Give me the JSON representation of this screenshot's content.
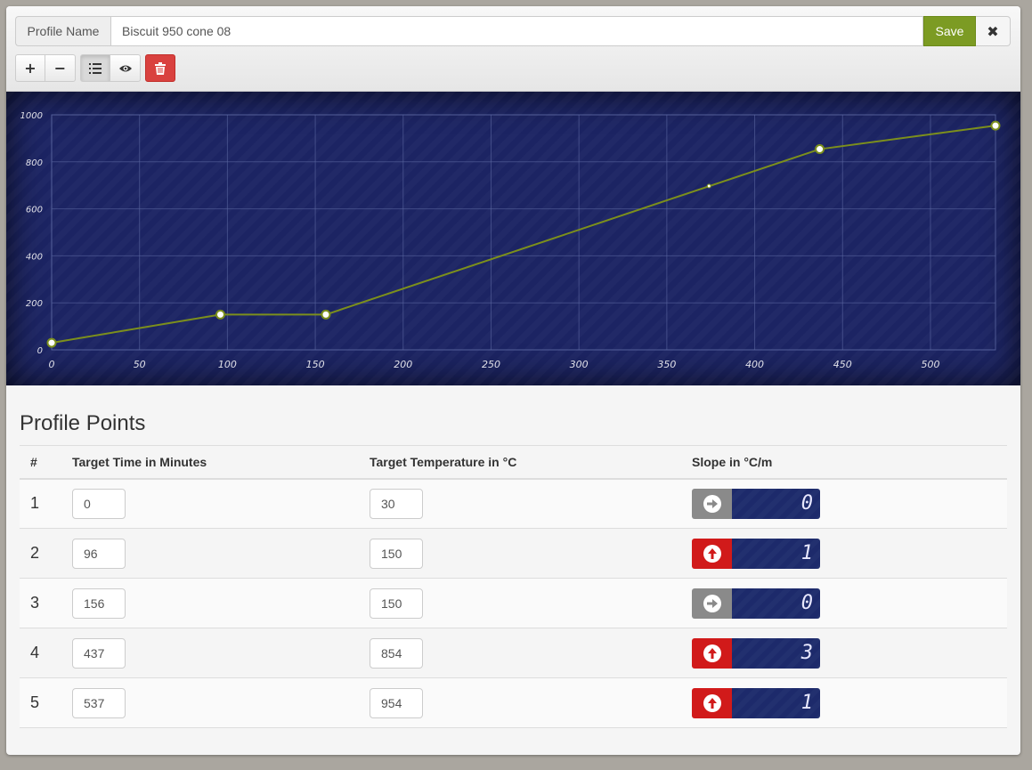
{
  "profile": {
    "name_label": "Profile Name",
    "name_value": "Biscuit 950 cone 08",
    "save_label": "Save",
    "close_glyph": "✖"
  },
  "toolbar": {
    "add_glyph": "+",
    "remove_glyph": "−",
    "list_icon": "list-icon",
    "view_icon": "eye-icon",
    "delete_icon": "trash-icon"
  },
  "chart_data": {
    "type": "line",
    "x": [
      0,
      96,
      156,
      437,
      537
    ],
    "y": [
      30,
      150,
      150,
      854,
      954
    ],
    "midpoint_marker": {
      "x": 374,
      "y": 697
    },
    "xlim": [
      0,
      537
    ],
    "ylim": [
      0,
      1000
    ],
    "xticks": [
      0,
      50,
      100,
      150,
      200,
      250,
      300,
      350,
      400,
      450,
      500
    ],
    "yticks": [
      0,
      200,
      400,
      600,
      800,
      1000
    ],
    "grid": true,
    "colors": {
      "background": "#1c2463",
      "line": "#7c8f1c",
      "point_fill": "#ffffff",
      "grid": "#5a66a0",
      "tick_text": "#e0e0e8"
    }
  },
  "points_section": {
    "title": "Profile Points",
    "headers": [
      "#",
      "Target Time in Minutes",
      "Target Temperature in °C",
      "Slope in °C/m"
    ],
    "rows": [
      {
        "index": "1",
        "time": "0",
        "temp": "30",
        "slope": "0",
        "direction": "flat"
      },
      {
        "index": "2",
        "time": "96",
        "temp": "150",
        "slope": "1",
        "direction": "up"
      },
      {
        "index": "3",
        "time": "156",
        "temp": "150",
        "slope": "0",
        "direction": "flat"
      },
      {
        "index": "4",
        "time": "437",
        "temp": "854",
        "slope": "3",
        "direction": "up"
      },
      {
        "index": "5",
        "time": "537",
        "temp": "954",
        "slope": "1",
        "direction": "up"
      }
    ]
  },
  "colors": {
    "save": "#7c9b23",
    "delete": "#d9413f",
    "slope_up": "#d11a1a",
    "slope_flat": "#8a8a8a"
  }
}
